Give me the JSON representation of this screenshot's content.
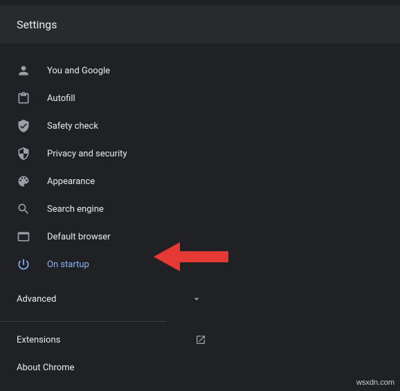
{
  "header": {
    "title": "Settings"
  },
  "nav": {
    "items": [
      {
        "label": "You and Google"
      },
      {
        "label": "Autofill"
      },
      {
        "label": "Safety check"
      },
      {
        "label": "Privacy and security"
      },
      {
        "label": "Appearance"
      },
      {
        "label": "Search engine"
      },
      {
        "label": "Default browser"
      },
      {
        "label": "On startup"
      }
    ]
  },
  "advanced": {
    "label": "Advanced"
  },
  "footer": {
    "extensions": "Extensions",
    "about": "About Chrome"
  },
  "watermark": "wsxdn.com"
}
